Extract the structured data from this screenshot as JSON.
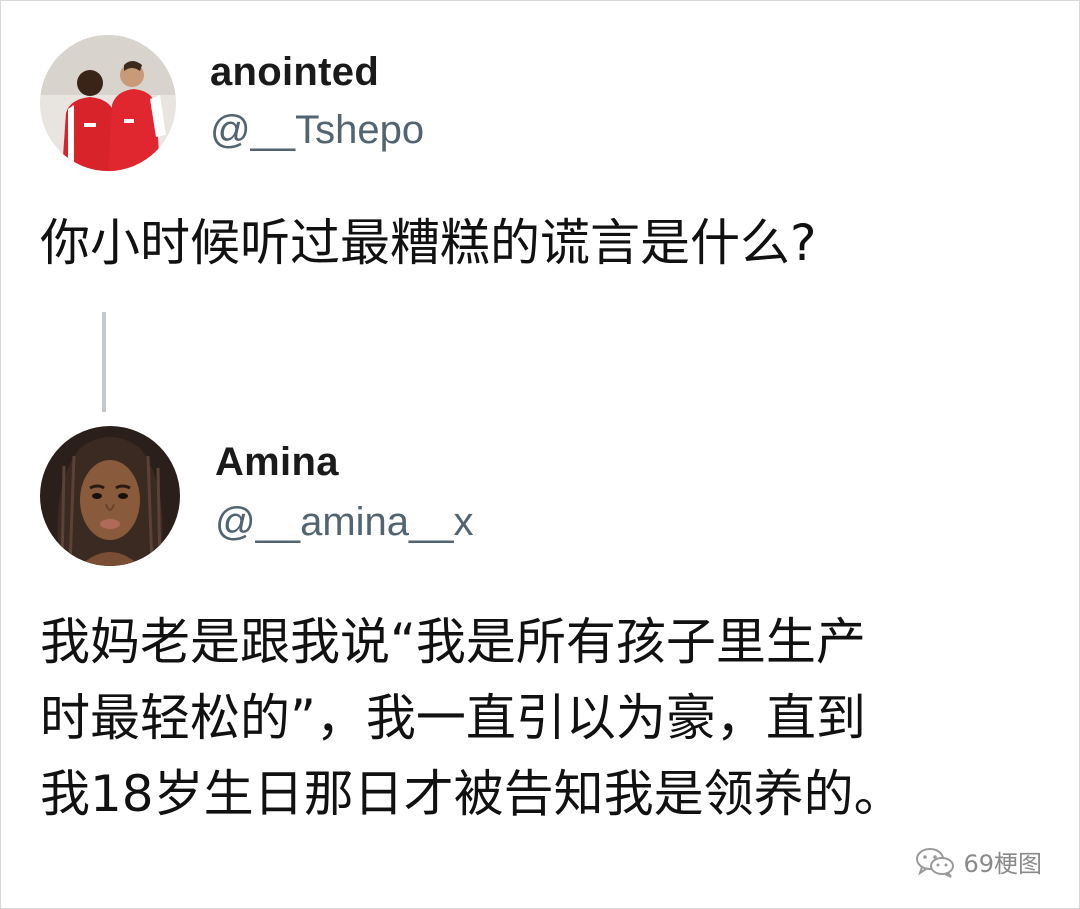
{
  "tweets": [
    {
      "display_name": "anointed",
      "handle": "@__Tshepo",
      "text": "你小时候听过最糟糕的谎言是什么?",
      "avatar_icon": "avatar-football-players-icon"
    },
    {
      "display_name": "Amina",
      "handle": "@__amina__x",
      "text_lines": [
        "我妈老是跟我说“我是所有孩子里生产",
        "时最轻松的”，我一直引以为豪，直到",
        "我18岁生日那日才被告知我是领养的。"
      ],
      "avatar_icon": "avatar-woman-portrait-icon"
    }
  ],
  "watermark": {
    "label": "69梗图",
    "icon": "wechat-icon"
  },
  "colors": {
    "handle": "#536471",
    "thread_line": "#c4c9ce",
    "text": "#111111"
  }
}
